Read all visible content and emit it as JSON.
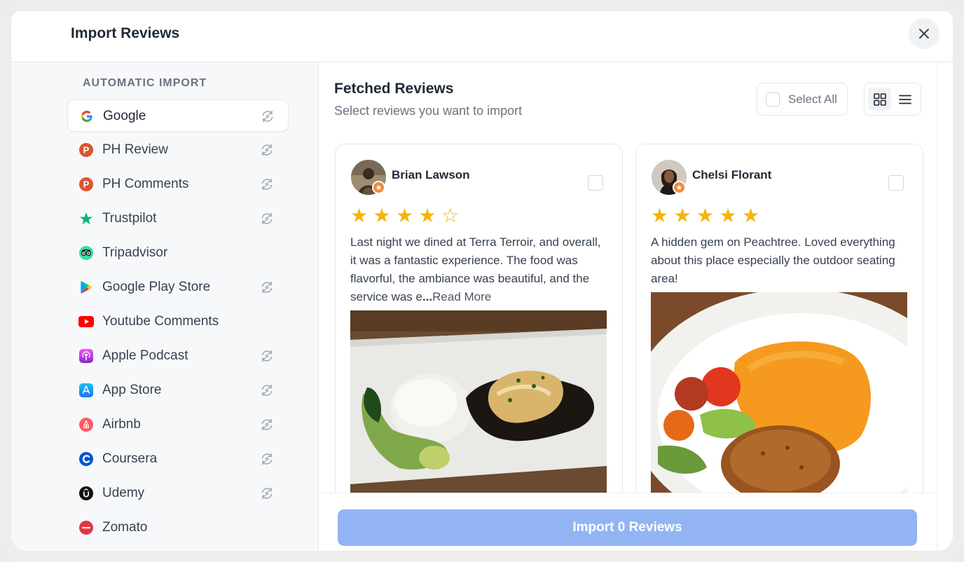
{
  "modal": {
    "title": "Import Reviews"
  },
  "sidebar": {
    "section_label": "AUTOMATIC IMPORT",
    "items": [
      {
        "label": "Google",
        "icon": "google-icon",
        "active": true,
        "sync": true
      },
      {
        "label": "PH Review",
        "icon": "producthunt-icon",
        "active": false,
        "sync": true
      },
      {
        "label": "PH Comments",
        "icon": "producthunt-icon",
        "active": false,
        "sync": true
      },
      {
        "label": "Trustpilot",
        "icon": "trustpilot-icon",
        "active": false,
        "sync": true
      },
      {
        "label": "Tripadvisor",
        "icon": "tripadvisor-icon",
        "active": false,
        "sync": false
      },
      {
        "label": "Google Play Store",
        "icon": "google-play-icon",
        "active": false,
        "sync": true
      },
      {
        "label": "Youtube Comments",
        "icon": "youtube-icon",
        "active": false,
        "sync": false
      },
      {
        "label": "Apple Podcast",
        "icon": "apple-podcast-icon",
        "active": false,
        "sync": true
      },
      {
        "label": "App Store",
        "icon": "app-store-icon",
        "active": false,
        "sync": true
      },
      {
        "label": "Airbnb",
        "icon": "airbnb-icon",
        "active": false,
        "sync": true
      },
      {
        "label": "Coursera",
        "icon": "coursera-icon",
        "active": false,
        "sync": true
      },
      {
        "label": "Udemy",
        "icon": "udemy-icon",
        "active": false,
        "sync": true
      },
      {
        "label": "Zomato",
        "icon": "zomato-icon",
        "active": false,
        "sync": false
      }
    ]
  },
  "main": {
    "title": "Fetched Reviews",
    "subtitle": "Select reviews you want to import",
    "select_all_label": "Select All",
    "view_mode": "grid"
  },
  "reviews": [
    {
      "name": "Brian Lawson",
      "rating": 4,
      "stars": "★★★★☆",
      "text": "Last night we dined at Terra Terroir, and overall, it was a fantastic experience. The food was flavorful, the ambiance was beautiful, and the service was e",
      "ellipsis": "...",
      "read_more": "Read More"
    },
    {
      "name": "Chelsi Florant",
      "rating": 5,
      "stars": "★★★★★",
      "text": "A hidden gem on Peachtree. Loved everything about this place especially the outdoor seating area!"
    }
  ],
  "footer": {
    "import_button_label": "Import 0 Reviews"
  },
  "colors": {
    "accent_button": "#93b4f2",
    "star": "#f5b50a",
    "sidebar_bg": "#f7f8fa",
    "badge": "#f08b3a"
  }
}
